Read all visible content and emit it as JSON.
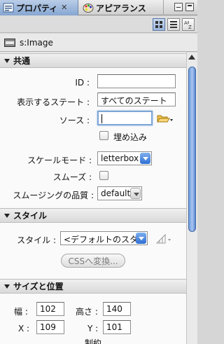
{
  "tabs": {
    "properties_label": "プロパティ",
    "appearance_label": "アピアランス",
    "close_glyph": "✕"
  },
  "component": {
    "title": "s:Image"
  },
  "common": {
    "header": "共通",
    "id_label": "ID :",
    "id_value": "",
    "display_state_label": "表示するステート :",
    "display_state_value": "すべてのステート",
    "source_label": "ソース :",
    "source_value": "",
    "embed_label": "埋め込み",
    "scale_mode_label": "スケールモード :",
    "scale_mode_value": "letterbox",
    "smooth_label": "スムーズ :",
    "smoothing_quality_label": "スムージングの品質 :",
    "smoothing_quality_value": "default"
  },
  "style": {
    "header": "スタイル",
    "style_label": "スタイル :",
    "style_value": "<デフォルトのスタ",
    "convert_css_label": "CSSへ変換..."
  },
  "size_position": {
    "header": "サイズと位置",
    "width_label": "幅 :",
    "width_value": "102",
    "height_label": "高さ :",
    "height_value": "140",
    "x_label": "X :",
    "x_value": "109",
    "y_label": "Y :",
    "y_value": "101",
    "constraints_label": "制約"
  },
  "colors": {
    "accent": "#2e6ed4",
    "focus_ring": "#7ea6d8",
    "section_bg": "#d9d9d9"
  }
}
